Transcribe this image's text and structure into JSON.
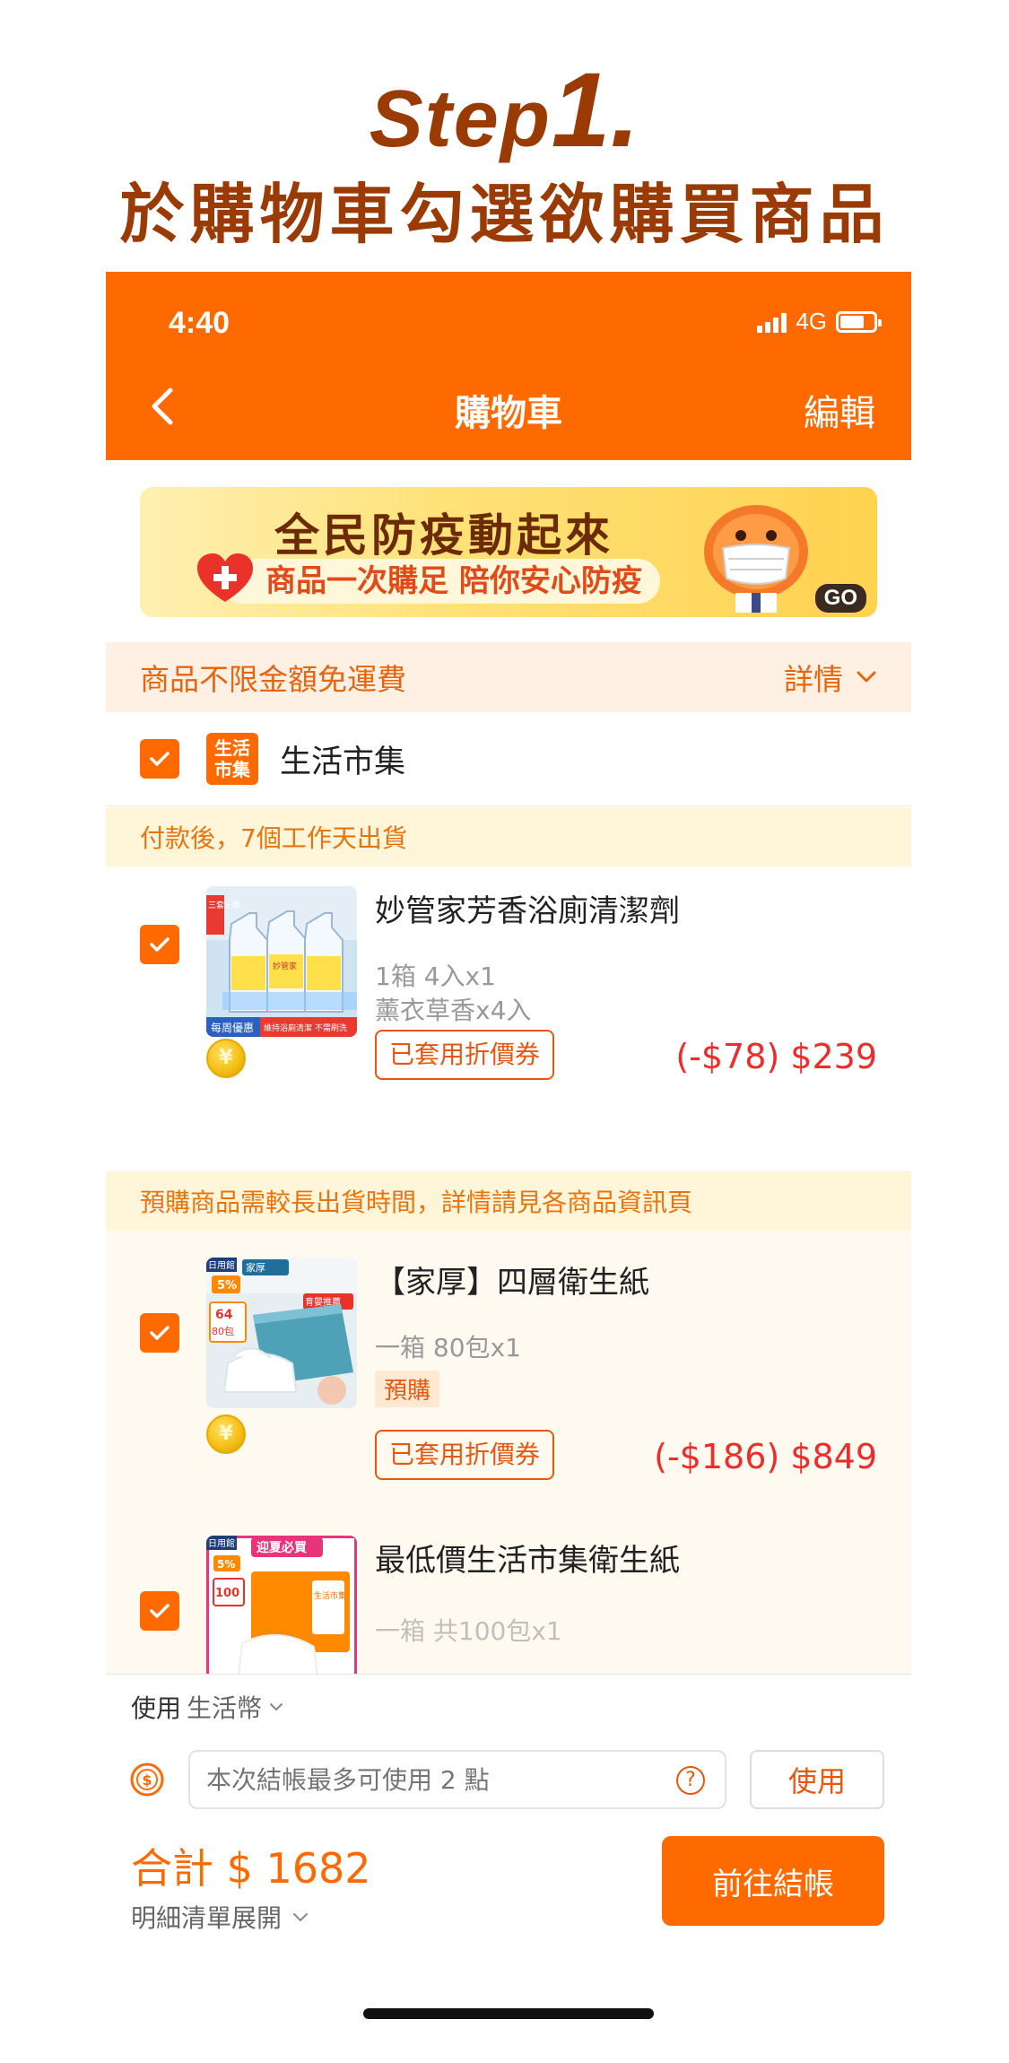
{
  "step": {
    "word": "Step",
    "number": "1.",
    "subtitle": "於購物車勾選欲購買商品"
  },
  "status_bar": {
    "time": "4:40",
    "network": "4G"
  },
  "nav": {
    "title": "購物車",
    "edit_label": "編輯"
  },
  "banner": {
    "headline": "全民防疫動起來",
    "subline": "商品一次購足 陪你安心防疫",
    "go_label": "GO"
  },
  "shipping": {
    "text": "商品不限金額免運費",
    "detail_label": "詳情"
  },
  "store": {
    "logo_text": [
      "生活",
      "市集"
    ],
    "name": "生活市集"
  },
  "notices": {
    "ship_after_payment": "付款後，7個工作天出貨",
    "preorder": "預購商品需較長出貨時間，詳情請見各商品資訊頁"
  },
  "products": [
    {
      "name": "妙管家芳香浴廁清潔劑",
      "spec_lines": [
        "1箱 4入x1",
        "薰衣草香x4入"
      ],
      "image_labels": [
        "三套正牌",
        "妙管家",
        "每周優惠",
        "維持浴廁清潔 不需刷洗"
      ],
      "coupon_label": "已套用折價券",
      "price": "(-$78) $239"
    },
    {
      "name": "【家厚】四層衛生紙",
      "spec_lines": [
        "一箱 80包x1"
      ],
      "image_labels": [
        "日用館",
        "5%",
        "64",
        "80包",
        "家厚",
        "育嬰推薦"
      ],
      "tag": "預購",
      "coupon_label": "已套用折價券",
      "price": "(-$186) $849"
    },
    {
      "name": "最低價生活市集衛生紙",
      "spec_lines": [
        "一箱 共100包x1"
      ],
      "image_labels": [
        "日用館",
        "迎夏必買",
        "5%",
        "100",
        "生活市集"
      ]
    }
  ],
  "payment": {
    "use_label": "使用",
    "currency_label": "生活幣",
    "points_placeholder": "本次結帳最多可使用 2 點",
    "use_button": "使用",
    "total": "合計 $ 1682",
    "detail_expand": "明細清單展開",
    "checkout": "前往結帳"
  },
  "colors": {
    "brand": "#ff6a00",
    "price_red": "#ee2c2c",
    "step_brown": "#9a3b06"
  }
}
